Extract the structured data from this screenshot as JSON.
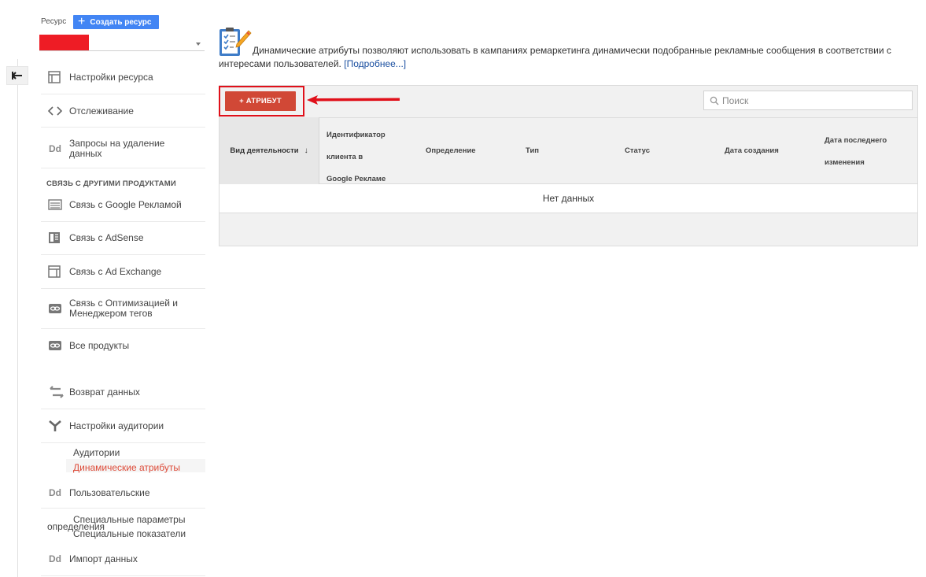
{
  "sidebar": {
    "resource_label": "Ресурс",
    "create_button": "Создать ресурс",
    "items": [
      {
        "label": "Настройки ресурса",
        "icon": "window-icon"
      },
      {
        "label": "Отслеживание",
        "icon": "code-icon"
      },
      {
        "label": "Запросы на удаление данных",
        "icon": "dd-icon"
      }
    ],
    "section_title": "СВЯЗЬ С ДРУГИМИ ПРОДУКТАМИ",
    "links": [
      {
        "label": "Связь с Google Рекламой",
        "icon": "ads-icon"
      },
      {
        "label": "Связь с AdSense",
        "icon": "adsense-icon"
      },
      {
        "label": "Связь с Ad Exchange",
        "icon": "window-icon"
      },
      {
        "label": "Связь с Оптимизацией и Менеджером тегов",
        "icon": "link-icon"
      },
      {
        "label": "Все продукты",
        "icon": "link-icon"
      }
    ],
    "other": [
      {
        "label": "Возврат данных",
        "icon": "swap-icon"
      },
      {
        "label": "Настройки аудитории",
        "icon": "fork-icon"
      }
    ],
    "audience_sub": [
      "Аудитории",
      "Динамические атрибуты"
    ],
    "custom": {
      "label": "Пользовательские",
      "overlap_label": "определения",
      "sub": [
        "Специальные параметры",
        "Специальные показатели"
      ]
    },
    "import": "Импорт данных"
  },
  "main": {
    "description": "Динамические атрибуты позволяют использовать в кампаниях ремаркетинга динамически подобранные рекламные сообщения в соответствии с интересами пользователей.",
    "more_link": "[Подробнее...]",
    "add_button": "+ АТРИБУТ",
    "search_placeholder": "Поиск",
    "columns": {
      "activity": "Вид деятельности",
      "client_id": [
        "Идентификатор",
        "клиента в",
        "Google Рекламе"
      ],
      "definition": "Определение",
      "type": "Тип",
      "status": "Статус",
      "created": "Дата создания",
      "modified": [
        "Дата последнего",
        "изменения"
      ]
    },
    "empty_text": "Нет данных"
  },
  "colors": {
    "accent_blue": "#4285f4",
    "add_button_red": "#d14836",
    "highlight_red": "#e0101a",
    "active_item": "#dd4b39"
  }
}
